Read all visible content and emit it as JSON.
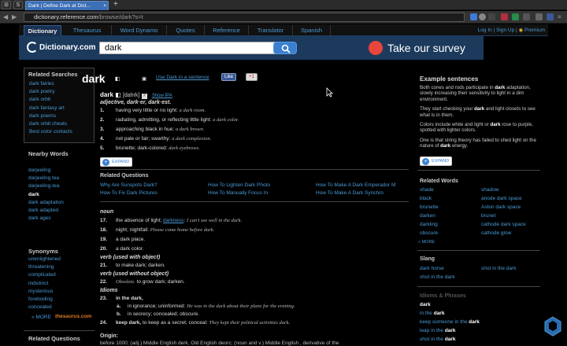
{
  "browser": {
    "active_tab_title": "Dark | Define Dark at Dict...",
    "new_tab": "+",
    "url_host": "dictionary.reference.com",
    "url_path": "/browse/dark?s=t",
    "back": "◀",
    "forward": "▶",
    "reload": "↻"
  },
  "nav": {
    "tabs": [
      "Dictionary",
      "Thesaurus",
      "Word Dynamo",
      "Quotes",
      "Reference",
      "Translator",
      "Spanish"
    ],
    "login": "Log In",
    "signup": "Sign Up",
    "premium": "Premium"
  },
  "banner": {
    "logo": "Dictionary.com",
    "search_value": "dark",
    "survey": "Take our survey"
  },
  "related_searches": {
    "heading": "Related Searches",
    "items": [
      "dark fairies",
      "dark poetry",
      "dark orbit",
      "dark fantasy art",
      "dark poems",
      "dark orbit cheats",
      "Best color contacts"
    ]
  },
  "nearby_words": {
    "heading": "Nearby Words",
    "items": [
      "darjeeling",
      "darjeeling tea",
      "darjeeling-tea",
      "dark",
      "dark adaptation",
      "dark adapted",
      "dark ages"
    ]
  },
  "synonyms": {
    "heading": "Synonyms",
    "items": [
      "unenlightened",
      "threatening",
      "complicated",
      "indistinct",
      "mysterious",
      "foreboding",
      "concealed"
    ],
    "more": "» MORE",
    "source": "thesaurus.com"
  },
  "related_questions_left": {
    "heading": "Related Questions"
  },
  "entry": {
    "headword": "dark",
    "use_in_sentence": "Use Dark in a sentence",
    "like": "Like",
    "plus": "+1",
    "pron_word": "dark",
    "pron": "[dahrk]",
    "show_ipa": "Show IPA",
    "adjective_line": "adjective, dark·er, dark·est.",
    "adj_defs": [
      {
        "n": "1.",
        "text": "having very little or no light:",
        "ex": "a dark room."
      },
      {
        "n": "2.",
        "text": "radiating, admitting, or reflecting little light:",
        "ex": "a dark color."
      },
      {
        "n": "3.",
        "text": "approaching black in hue:",
        "ex": "a dark brown."
      },
      {
        "n": "4.",
        "text": "not pale or fair; swarthy:",
        "ex": "a dark complexion."
      },
      {
        "n": "5.",
        "text": "brunette; dark-colored:",
        "ex": "dark eyebrows."
      }
    ],
    "expand": "EXPAND",
    "rq_heading": "Related Questions",
    "related_questions": [
      [
        "Why Are Sunspots Dark?",
        "How To Lighten Dark Photo",
        "How To Make A Dark Emperador M"
      ],
      [
        "How To Fix Dark Pictures",
        "How To Manually Focus In",
        "How To Make A Dark Synchro"
      ]
    ],
    "noun_label": "noun",
    "noun_defs": [
      {
        "n": "17.",
        "text": "the absence of light;",
        "link": "darkness",
        "ex": "I can't see well in the dark."
      },
      {
        "n": "18.",
        "text": "night; nightfall:",
        "ex": "Please come home before dark."
      },
      {
        "n": "19.",
        "text": "a dark place."
      },
      {
        "n": "20.",
        "text": "a dark color."
      }
    ],
    "verb_obj_label": "verb (used with object)",
    "verb_obj_def": {
      "n": "21.",
      "text": "to make dark; darken."
    },
    "verb_noobj_label": "verb (used without object)",
    "verb_noobj_def": {
      "n": "22.",
      "ex": "Obsolete.",
      "text": "to grow dark; darken."
    },
    "idioms_label": "Idioms",
    "idiom23": {
      "n": "23.",
      "text": "in the dark,"
    },
    "idiom23a": {
      "n": "a.",
      "text": "in ignorance; uninformed:",
      "ex": "He was in the dark about their plans for the evening."
    },
    "idiom23b": {
      "n": "b.",
      "text": "in secrecy; concealed; obscure."
    },
    "idiom24": {
      "n": "24.",
      "bold": "keep dark,",
      "text": "to keep as a secret; conceal:",
      "ex": "They kept their political activities dark."
    },
    "origin_label": "Origin:",
    "origin_text": "before 1000;  (adj.) Middle English derk, Old English deorc;  (noun and v.) Middle English , derivative of the"
  },
  "examples": {
    "heading": "Example sentences",
    "items": [
      [
        "Both cones and rods participate in ",
        "dark",
        " adaptation, slowly increasing their sensitivity to light in a dim environment."
      ],
      [
        "They start checking your ",
        "dark",
        " and light closets to see what is in them."
      ],
      [
        "Colors include white and light or ",
        "dark",
        " rose to purple, spotted with lighter colors."
      ],
      [
        "One is that string theory has failed to shed light on the nature of ",
        "dark",
        " energy."
      ]
    ],
    "expand": "EXPAND"
  },
  "related_words": {
    "heading": "Related Words",
    "col1": [
      "shade",
      "black",
      "brunette",
      "darken",
      "darkling",
      "obscure"
    ],
    "col2": [
      "shadow",
      "anode dark space",
      "Aston dark space",
      "brunet",
      "cathode dark space",
      "cathode glow"
    ],
    "more": "» MORE"
  },
  "slang": {
    "heading": "Slang",
    "items": [
      "dark horse",
      "shot in the dark",
      "shot in the dark"
    ]
  },
  "idioms_phrases": {
    "heading": "Idioms & Phrases",
    "items": [
      [
        "",
        "dark"
      ],
      [
        "in the ",
        "dark"
      ],
      [
        "keep someone in the ",
        "dark"
      ],
      [
        "leap in the ",
        "dark"
      ],
      [
        "shot in the ",
        "dark"
      ]
    ]
  }
}
